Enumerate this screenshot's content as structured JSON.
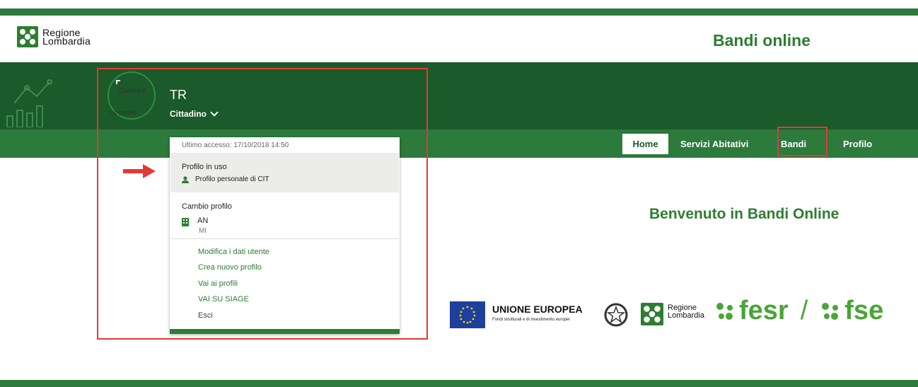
{
  "header": {
    "logo_line1": "Regione",
    "logo_line2": "Lombardia",
    "app_title": "Bandi online"
  },
  "user": {
    "avatar_text_top": "Cambia il",
    "avatar_text_bottom": "uo profilo",
    "initials": "TR",
    "role": "Cittadino"
  },
  "dropdown": {
    "last_access": "Ultimo accesso: 17/10/2018 14:50",
    "profile_in_use_title": "Profilo in uso",
    "profile_in_use_item": "Profilo personale di CIT",
    "change_profile_title": "Cambio profilo",
    "org_name": "AN",
    "org_city": "MI",
    "links": [
      "Modifica i dati utente",
      "Crea nuovo profilo",
      "Vai ai profili",
      "VAI SU SIAGE"
    ],
    "exit_label": "Esci"
  },
  "nav": {
    "home": "Home",
    "servizi": "Servizi Abitativi",
    "bandi": "Bandi",
    "profilo": "Profilo"
  },
  "main": {
    "welcome": "Benvenuto in Bandi Online"
  },
  "footer_logos": {
    "eu_title": "UNIONE EUROPEA",
    "eu_subtitle": "Fondi strutturali e di investimento europei",
    "rl_line1": "Regione",
    "rl_line2": "Lombardia",
    "fesr": "fesr",
    "slash": "/",
    "fse": "fse"
  },
  "colors": {
    "brand_green": "#2e7d32",
    "dark_band": "#1b5a2a",
    "highlight_red": "#e53935"
  },
  "icons": [
    "regione-lombardia-logo-icon",
    "growth-chart-icon",
    "chevron-down-icon",
    "person-icon",
    "building-icon",
    "red-arrow-icon",
    "eu-flag-icon",
    "italian-emblem-icon",
    "fesr-logo-icon",
    "fse-logo-icon"
  ]
}
